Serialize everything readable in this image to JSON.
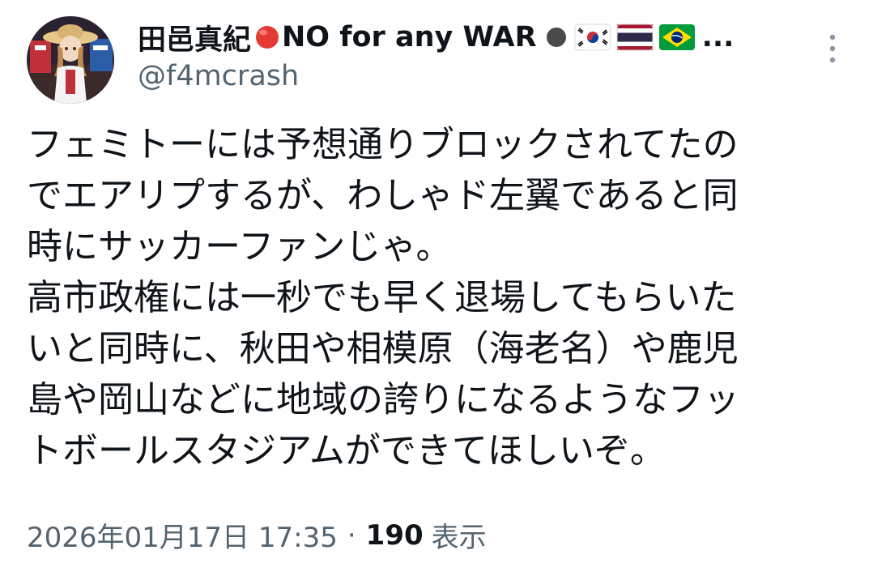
{
  "tweet": {
    "display_name_part1": "田邑真紀",
    "display_name_part2": "NO for any WAR",
    "name_emojis": [
      "red-circle",
      "black-circle",
      "flag-south-korea",
      "flag-thailand",
      "flag-brazil"
    ],
    "name_ellipsis": "...",
    "handle": "@f4mcrash",
    "text": "フェミトーには予想通りブロックされてたの\nでエアリプするが、わしゃド左翼であると同\n時にサッカーファンじゃ。\n高市政権には一秒でも早く退場してもらいた\nいと同時に、秋田や相模原（海老名）や鹿児\n島や岡山などに地域の誇りになるようなフッ\nトボールスタジアムができてほしいぞ。",
    "timestamp": "2026年01月17日 17:35",
    "separator": "·",
    "view_count": "190",
    "view_label": "表示"
  },
  "colors": {
    "primary_text": "#0f1419",
    "secondary_text": "#536471",
    "background": "#ffffff"
  },
  "icons": {
    "more": "more-vertical-icon",
    "avatar": "profile-avatar"
  }
}
